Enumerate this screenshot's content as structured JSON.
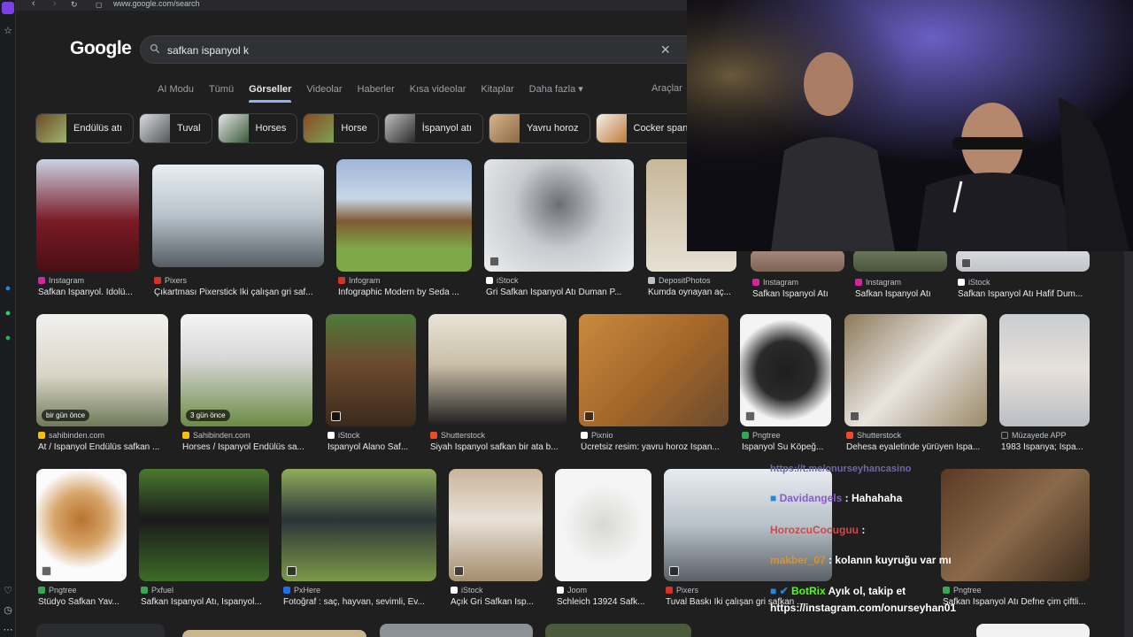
{
  "browser": {
    "url": "www.google.com/search"
  },
  "search": {
    "logo": "Google",
    "query": "safkan ispanyol k",
    "clear_label": "×"
  },
  "tabs": [
    "AI Modu",
    "Tümü",
    "Görseller",
    "Videolar",
    "Haberler",
    "Kısa videolar",
    "Kitaplar",
    "Daha fazla ▾"
  ],
  "tools_label": "Araçlar",
  "chips": [
    "Endülüs atı",
    "Tuval",
    "Horses",
    "Horse",
    "İspanyol atı",
    "Yavru horoz",
    "Cocker spaniel"
  ],
  "results": [
    {
      "source": "Instagram",
      "title": "Safkan İspanyol. İdolü...",
      "badge": ""
    },
    {
      "source": "Pixers",
      "title": "Çıkartması Pixerstick İki çalışan gri saf...",
      "badge": ""
    },
    {
      "source": "Infogram",
      "title": "Infographic Modern by Seda ...",
      "badge": ""
    },
    {
      "source": "iStock",
      "title": "Gri Safkan İspanyol Atı Duman P...",
      "badge": ""
    },
    {
      "source": "DepositPhotos",
      "title": "Kumda oynayan aç...",
      "badge": ""
    },
    {
      "source": "Instagram",
      "title": "Safkan İspanyol Atı",
      "badge": ""
    },
    {
      "source": "Instagram",
      "title": "Safkan İspanyol Atı",
      "badge": ""
    },
    {
      "source": "iStock",
      "title": "Safkan İspanyol Atı Hafif Dum...",
      "badge": ""
    },
    {
      "source": "sahibinden.com",
      "title": "At / İspanyol Endülüs safkan ...",
      "badge": "bir gün önce"
    },
    {
      "source": "Sahibinden.com",
      "title": "Horses / İspanyol Endülüs sa...",
      "badge": "3 gün önce"
    },
    {
      "source": "iStock",
      "title": "İspanyol Alano Saf...",
      "badge": ""
    },
    {
      "source": "Shutterstock",
      "title": "Siyah İspanyol safkan bir ata b...",
      "badge": ""
    },
    {
      "source": "Pixnio",
      "title": "Ücretsiz resim: yavru horoz İspan...",
      "badge": ""
    },
    {
      "source": "Pngtree",
      "title": "İspanyol Su Köpeğ...",
      "badge": ""
    },
    {
      "source": "Shutterstock",
      "title": "Dehesa eyaletinde yürüyen İspa...",
      "badge": ""
    },
    {
      "source": "Müzayede APP",
      "title": "1983 İspanya; İspa...",
      "badge": ""
    },
    {
      "source": "Pngtree",
      "title": "Stüdyo Safkan Yav...",
      "badge": ""
    },
    {
      "source": "Pxfuel",
      "title": "Safkan İspanyol Atı, İspanyol...",
      "badge": ""
    },
    {
      "source": "PxHere",
      "title": "Fotoğraf : saç, hayvan, sevimli, Ev...",
      "badge": ""
    },
    {
      "source": "iStock",
      "title": "Açık Gri Safkan İsp...",
      "badge": ""
    },
    {
      "source": "Joom",
      "title": "Schleich 13924 Safk...",
      "badge": ""
    },
    {
      "source": "Pixers",
      "title": "Tuval Baskı İki çalışan gri safkan ...",
      "badge": ""
    },
    {
      "source": "Pngtree",
      "title": "Safkan İspanyol Atı Defne çim çiftli...",
      "badge": ""
    }
  ],
  "stream": {
    "chat": [
      {
        "user": "https://t.me/onurseyhancasino",
        "text": ""
      },
      {
        "user": "Davidangels",
        "text": " : Hahahaha"
      },
      {
        "user": "HorozcuCocuguu",
        "text": " :"
      },
      {
        "user": "makber_07",
        "text": " : kolanın kuyruğu var mı"
      },
      {
        "user": "BotRix",
        "text": " Ayık ol, takip et"
      },
      {
        "user": "https://instagram.com/onurseyhan01",
        "text": ""
      }
    ]
  },
  "colors": {
    "accent": "#8ab4f8",
    "bg": "#1f1f1f",
    "text": "#e8eaed"
  }
}
